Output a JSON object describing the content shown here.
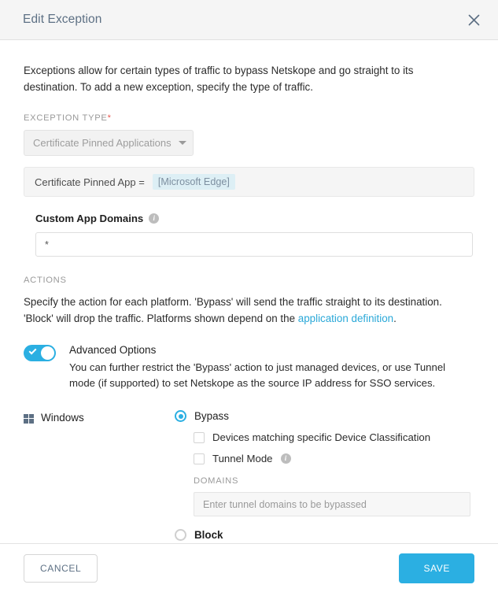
{
  "header": {
    "title": "Edit Exception",
    "close_icon": "close-icon"
  },
  "intro": "Exceptions allow for certain types of traffic to bypass Netskope and go straight to its destination. To add a new exception, specify the type of traffic.",
  "exception_type": {
    "label": "EXCEPTION TYPE",
    "required_marker": "*",
    "selected": "Certificate Pinned Applications",
    "caret_icon": "chevron-down-icon"
  },
  "criteria": {
    "key": "Certificate Pinned App =",
    "chip": "[Microsoft Edge]"
  },
  "custom_app_domains": {
    "label": "Custom App Domains",
    "info_icon": "info-icon",
    "value": "*",
    "placeholder": ""
  },
  "actions": {
    "label": "ACTIONS",
    "description_part1": "Specify the action for each platform. 'Bypass' will send the traffic straight to its destination. 'Block' will drop the traffic. Platforms shown depend on the ",
    "link_text": "application definition",
    "description_part2": "."
  },
  "advanced_options": {
    "title": "Advanced Options",
    "description": "You can further restrict the 'Bypass' action to just managed devices, or use Tunnel mode (if supported) to set Netskope as the source IP address for SSO services.",
    "toggle_state": "on",
    "toggle_icon": "check-icon"
  },
  "platform": {
    "name": "Windows",
    "icon": "windows-icon",
    "bypass": {
      "label": "Bypass",
      "selected": true
    },
    "device_classification": {
      "label": "Devices matching specific Device Classification",
      "checked": false
    },
    "tunnel_mode": {
      "label": "Tunnel Mode",
      "info_icon": "info-icon",
      "checked": false
    },
    "domains": {
      "label": "DOMAINS",
      "placeholder": "Enter tunnel domains to be bypassed",
      "value": ""
    },
    "block": {
      "label": "Block",
      "selected": false
    }
  },
  "footer": {
    "cancel_label": "CANCEL",
    "save_label": "SAVE"
  },
  "colors": {
    "accent": "#2bafe2",
    "header_bg": "#f5f5f5",
    "title_text": "#5d7084",
    "required": "#e8554e",
    "chip_bg": "#ddeff5"
  }
}
